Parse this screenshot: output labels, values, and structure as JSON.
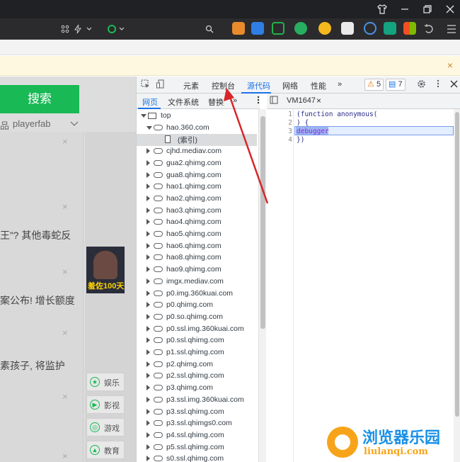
{
  "titlebar": {
    "shirt_icon": "tshirt-icon",
    "restore_icon": "restore-icon",
    "close_icon": "close-icon"
  },
  "toolbar": {
    "icons": [
      "grid-icon",
      "lightning-icon",
      "chevron-down-icon",
      "search-icon",
      "extension-icons",
      "undo-icon",
      "menu-icon"
    ]
  },
  "infobar": {
    "close_label": "×"
  },
  "page": {
    "search_button": "搜索",
    "strip_items": [
      "品",
      "playerfab"
    ],
    "news": [
      {
        "text": "王”? 其他毒蛇反"
      },
      {
        "text": "案公布! 增长额度"
      },
      {
        "text": "素孩子, 将监护"
      }
    ],
    "thumb_caption": "羞佐100天",
    "categories": [
      "娱乐",
      "影视",
      "游戏",
      "教育"
    ]
  },
  "devtools": {
    "tabs": [
      "元素",
      "控制台",
      "源代码",
      "网络",
      "性能"
    ],
    "active_tab": "源代码",
    "more_tabs": "»",
    "warning_count": "5",
    "message_count": "7",
    "nav_tabs": [
      "网页",
      "文件系统",
      "替换"
    ],
    "nav_more": "»",
    "editor_tab": "VM1647",
    "tree": [
      {
        "label": "top",
        "type": "folder",
        "expanded": true,
        "level": 0
      },
      {
        "label": "hao.360.com",
        "type": "cloud",
        "expanded": true,
        "level": 1
      },
      {
        "label": "(索引)",
        "type": "file",
        "level": 2,
        "selected": true
      },
      {
        "label": "cjhd.mediav.com",
        "type": "cloud",
        "level": 1
      },
      {
        "label": "gua2.qhimg.com",
        "type": "cloud",
        "level": 1
      },
      {
        "label": "gua8.qhimg.com",
        "type": "cloud",
        "level": 1
      },
      {
        "label": "hao1.qhimg.com",
        "type": "cloud",
        "level": 1
      },
      {
        "label": "hao2.qhimg.com",
        "type": "cloud",
        "level": 1
      },
      {
        "label": "hao3.qhimg.com",
        "type": "cloud",
        "level": 1
      },
      {
        "label": "hao4.qhimg.com",
        "type": "cloud",
        "level": 1
      },
      {
        "label": "hao5.qhimg.com",
        "type": "cloud",
        "level": 1
      },
      {
        "label": "hao6.qhimg.com",
        "type": "cloud",
        "level": 1
      },
      {
        "label": "hao8.qhimg.com",
        "type": "cloud",
        "level": 1
      },
      {
        "label": "hao9.qhimg.com",
        "type": "cloud",
        "level": 1
      },
      {
        "label": "imgx.mediav.com",
        "type": "cloud",
        "level": 1
      },
      {
        "label": "p0.img.360kuai.com",
        "type": "cloud",
        "level": 1
      },
      {
        "label": "p0.qhimg.com",
        "type": "cloud",
        "level": 1
      },
      {
        "label": "p0.so.qhimg.com",
        "type": "cloud",
        "level": 1
      },
      {
        "label": "p0.ssl.img.360kuai.com",
        "type": "cloud",
        "level": 1
      },
      {
        "label": "p0.ssl.qhimg.com",
        "type": "cloud",
        "level": 1
      },
      {
        "label": "p1.ssl.qhimg.com",
        "type": "cloud",
        "level": 1
      },
      {
        "label": "p2.qhimg.com",
        "type": "cloud",
        "level": 1
      },
      {
        "label": "p2.ssl.qhimg.com",
        "type": "cloud",
        "level": 1
      },
      {
        "label": "p3.qhimg.com",
        "type": "cloud",
        "level": 1
      },
      {
        "label": "p3.ssl.img.360kuai.com",
        "type": "cloud",
        "level": 1
      },
      {
        "label": "p3.ssl.qhimg.com",
        "type": "cloud",
        "level": 1
      },
      {
        "label": "p3.ssl.qhimgs0.com",
        "type": "cloud",
        "level": 1
      },
      {
        "label": "p4.ssl.qhimg.com",
        "type": "cloud",
        "level": 1
      },
      {
        "label": "p5.ssl.qhimg.com",
        "type": "cloud",
        "level": 1
      },
      {
        "label": "s0.ssl.qhimg.com",
        "type": "cloud",
        "level": 1
      }
    ],
    "code_lines": [
      {
        "num": "1",
        "text": "(function anonymous("
      },
      {
        "num": "2",
        "text": ") {"
      },
      {
        "num": "3",
        "text": "debugger"
      },
      {
        "num": "4",
        "text": "})"
      }
    ]
  },
  "watermark": {
    "title": "浏览器乐园",
    "url": "liulanqi.com"
  },
  "colors": {
    "accent": "#1a73e8",
    "search_green": "#19b955",
    "annotation_red": "#d7262a",
    "watermark_blue": "#1890e8",
    "watermark_orange": "#f7a41b"
  }
}
